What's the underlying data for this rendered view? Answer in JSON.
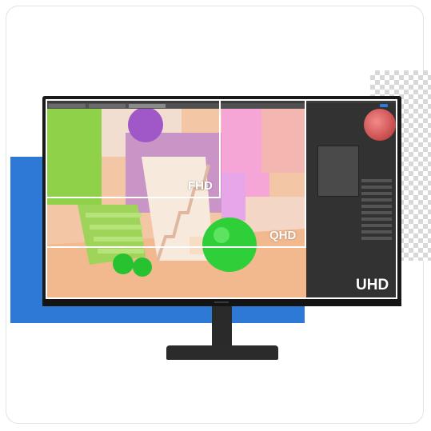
{
  "resolution_labels": {
    "fhd": "FHD",
    "qhd": "QHD",
    "uhd": "UHD"
  },
  "colors": {
    "accent_blue": "#2f79d6",
    "frame": "#ffffff",
    "monitor": "#1a1a1a"
  }
}
